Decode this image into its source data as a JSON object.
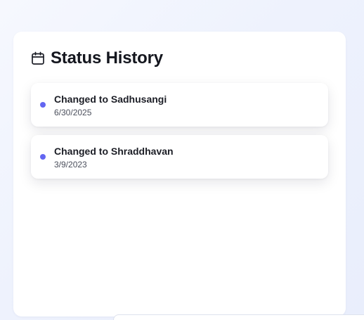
{
  "status_history": {
    "title": "Status History",
    "header_icon": "calendar-icon",
    "accent_color": "#6366f1",
    "items": [
      {
        "label": "Changed to Sadhusangi",
        "date": "6/30/2025"
      },
      {
        "label": "Changed to Shraddhavan",
        "date": "3/9/2023"
      }
    ]
  }
}
